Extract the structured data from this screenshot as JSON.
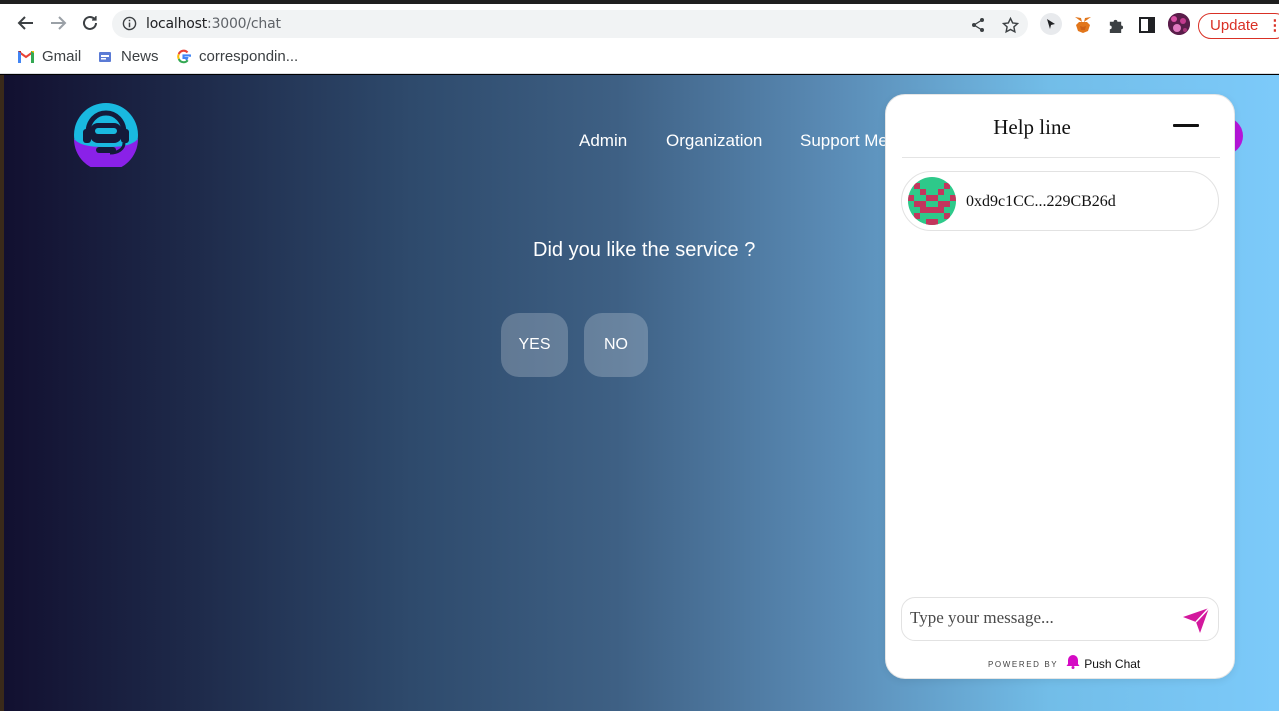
{
  "browser": {
    "url_host": "localhost",
    "url_path": ":3000/chat",
    "update_label": "Update",
    "bookmarks": [
      {
        "label": "Gmail",
        "icon": "gmail-icon"
      },
      {
        "label": "News",
        "icon": "news-icon"
      },
      {
        "label": "correspondin...",
        "icon": "google-icon"
      }
    ]
  },
  "site": {
    "nav": [
      "Admin",
      "Organization",
      "Support Me"
    ],
    "question": "Did you like the service ?",
    "yes_label": "YES",
    "no_label": "NO",
    "colors": {
      "accent": "#b516d9",
      "logo_cyan": "#1fc6e6",
      "logo_purple": "#8e20e8"
    }
  },
  "chat": {
    "title": "Help line",
    "contact_address": "0xd9c1CC...229CB26d",
    "message_placeholder": "Type your message...",
    "powered_by": "POWERED BY",
    "brand": "Push Chat",
    "colors": {
      "send": "#d3189d",
      "brand": "#d50ac4"
    }
  }
}
